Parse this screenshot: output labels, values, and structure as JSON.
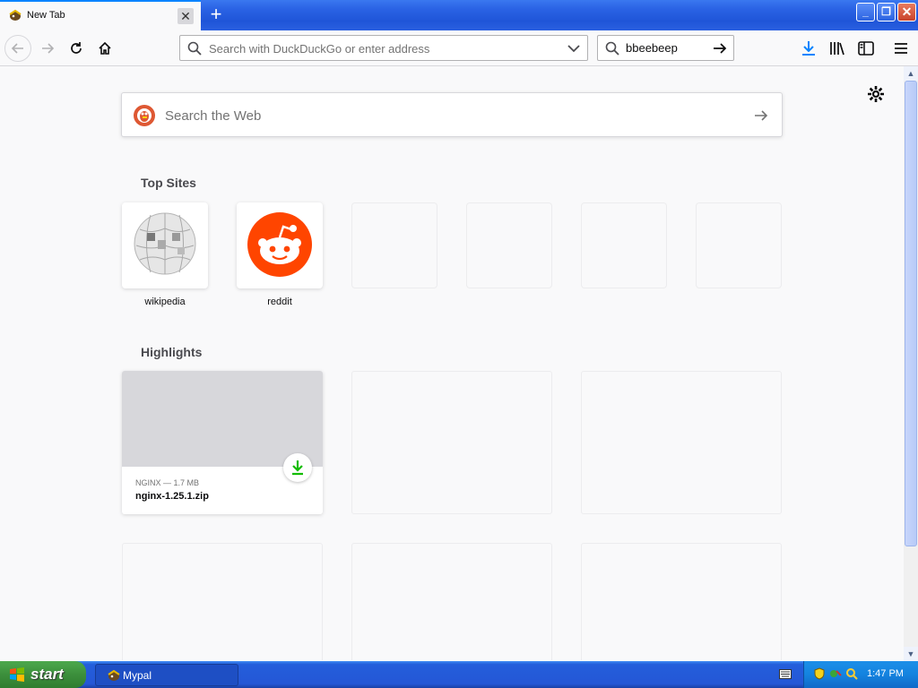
{
  "tab": {
    "title": "New Tab",
    "close_glyph": "✕",
    "new_tab_glyph": "+"
  },
  "window_controls": {
    "minimize": "_",
    "maximize": "❐",
    "close": "✕"
  },
  "toolbar": {
    "url_placeholder": "Search with DuckDuckGo or enter address",
    "search_value": "bbeebeep",
    "icons": [
      "back-arrow-icon",
      "forward-arrow-icon",
      "reload-icon",
      "home-icon",
      "download-icon",
      "library-icon",
      "sidebar-icon",
      "menu-icon"
    ]
  },
  "newtab": {
    "search_placeholder": "Search the Web",
    "top_sites_title": "Top Sites",
    "top_sites": [
      {
        "label": "wikipedia",
        "icon": "wikipedia-globe-icon"
      },
      {
        "label": "reddit",
        "icon": "reddit-alien-icon"
      },
      {
        "label": ""
      },
      {
        "label": ""
      },
      {
        "label": ""
      },
      {
        "label": ""
      }
    ],
    "highlights_title": "Highlights",
    "highlights": [
      {
        "meta": "NGINX — 1.7 MB",
        "name": "nginx-1.25.1.zip",
        "icon": "download-icon"
      }
    ]
  },
  "taskbar": {
    "start_label": "start",
    "app_label": "Mypal",
    "clock": "1:47 PM"
  },
  "colors": {
    "accent": "#0a84ff",
    "reddit": "#ff4500",
    "download_green": "#12bc00",
    "xp_blue": "#245edb",
    "xp_green": "#3c8f3c"
  }
}
